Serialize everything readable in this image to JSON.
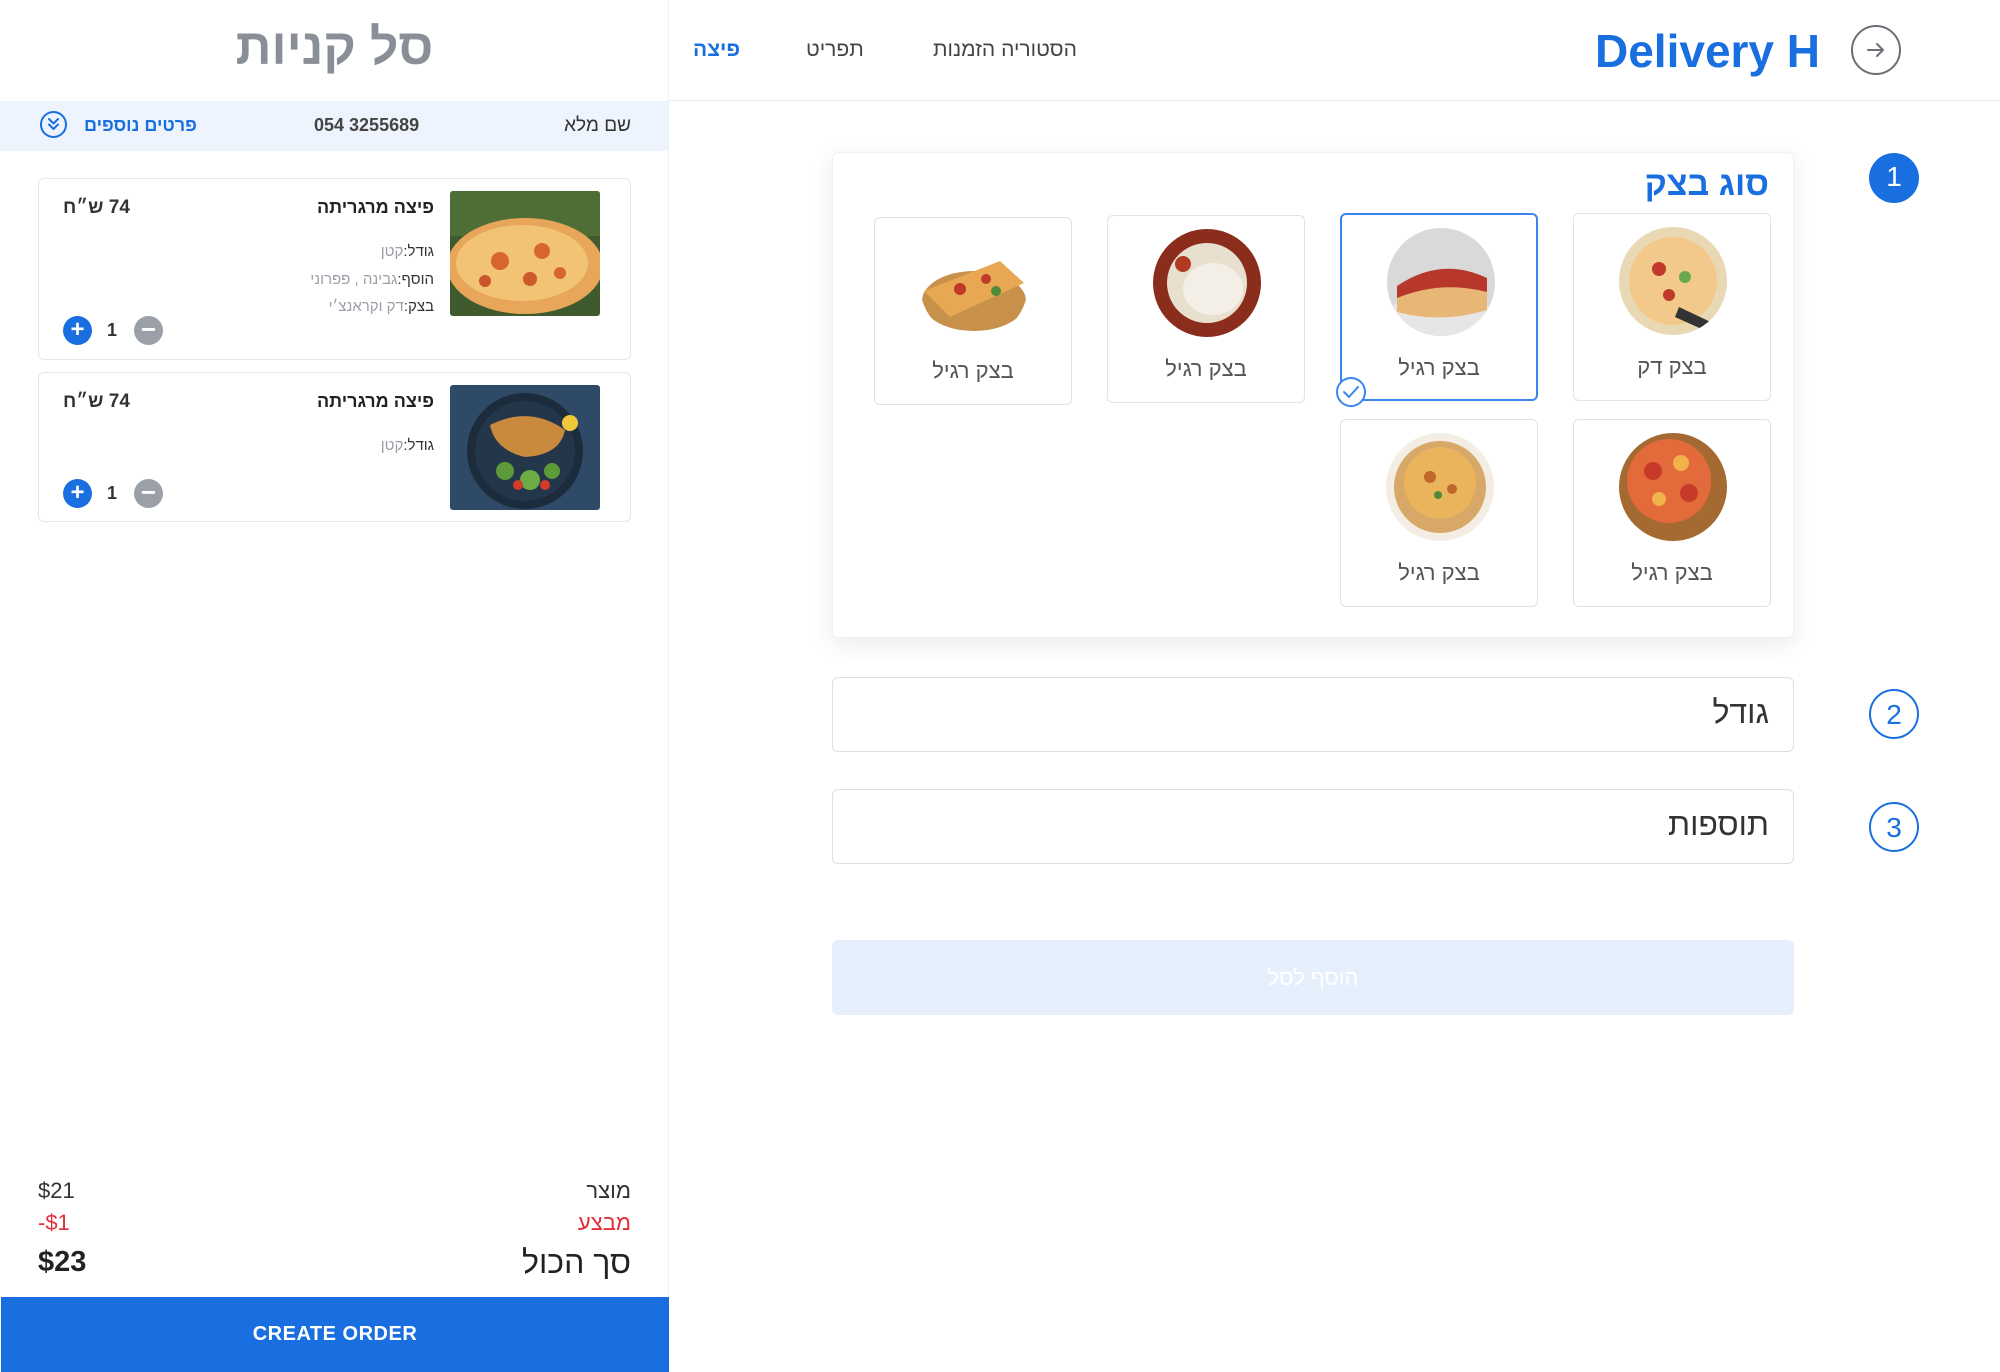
{
  "cart": {
    "title": "סל קניות",
    "customer": {
      "name_label": "שם מלא",
      "phone": "054 3255689",
      "more_label": "פרטים נוספים"
    },
    "items": [
      {
        "name": "פיצה מרגריתה",
        "price": "74 ש״ח",
        "details": [
          {
            "label": "גודל:",
            "value": "קטן"
          },
          {
            "label": "הוסף:",
            "value": "גבינה , פפרוני"
          },
          {
            "label": "בצק:",
            "value": "דק  וקראנצ׳י"
          }
        ],
        "quantity": "1"
      },
      {
        "name": "פיצה מרגריתה",
        "price": "74 ש״ח",
        "details": [
          {
            "label": "גודל:",
            "value": "קטן"
          }
        ],
        "quantity": "1"
      }
    ],
    "summary": {
      "product_label": "מוצר",
      "product_value": "$21",
      "discount_label": "מבצע",
      "discount_value": "-$1",
      "total_label": "סך הכול",
      "total_value": "$23"
    },
    "create_order": "CREATE ORDER"
  },
  "header": {
    "brand": "Delivery H",
    "nav": [
      {
        "label": "פיצה",
        "active": true
      },
      {
        "label": "תפריט",
        "active": false
      },
      {
        "label": "הסטוריה הזמנות",
        "active": false
      }
    ]
  },
  "steps": [
    "1",
    "2",
    "3"
  ],
  "dough": {
    "title": "סוג בצק",
    "options": [
      {
        "label": "בצק דק",
        "selected": false
      },
      {
        "label": "בצק רגיל",
        "selected": true
      },
      {
        "label": "בצק רגיל",
        "selected": false
      },
      {
        "label": "בצק רגיל",
        "selected": false
      },
      {
        "label": "בצק רגיל",
        "selected": false
      },
      {
        "label": "בצק רגיל",
        "selected": false
      }
    ]
  },
  "size_section": {
    "title": "גודל"
  },
  "toppings_section": {
    "title": "תוספות"
  },
  "add_to_cart": "הוסף לסל",
  "colors": {
    "accent": "#1a6fe0",
    "discount": "#e0303a",
    "disabled_button": "#e6f0fd"
  },
  "icons": {
    "back": "arrow-right-icon",
    "more": "double-chevron-down-icon",
    "selected": "check-icon"
  }
}
